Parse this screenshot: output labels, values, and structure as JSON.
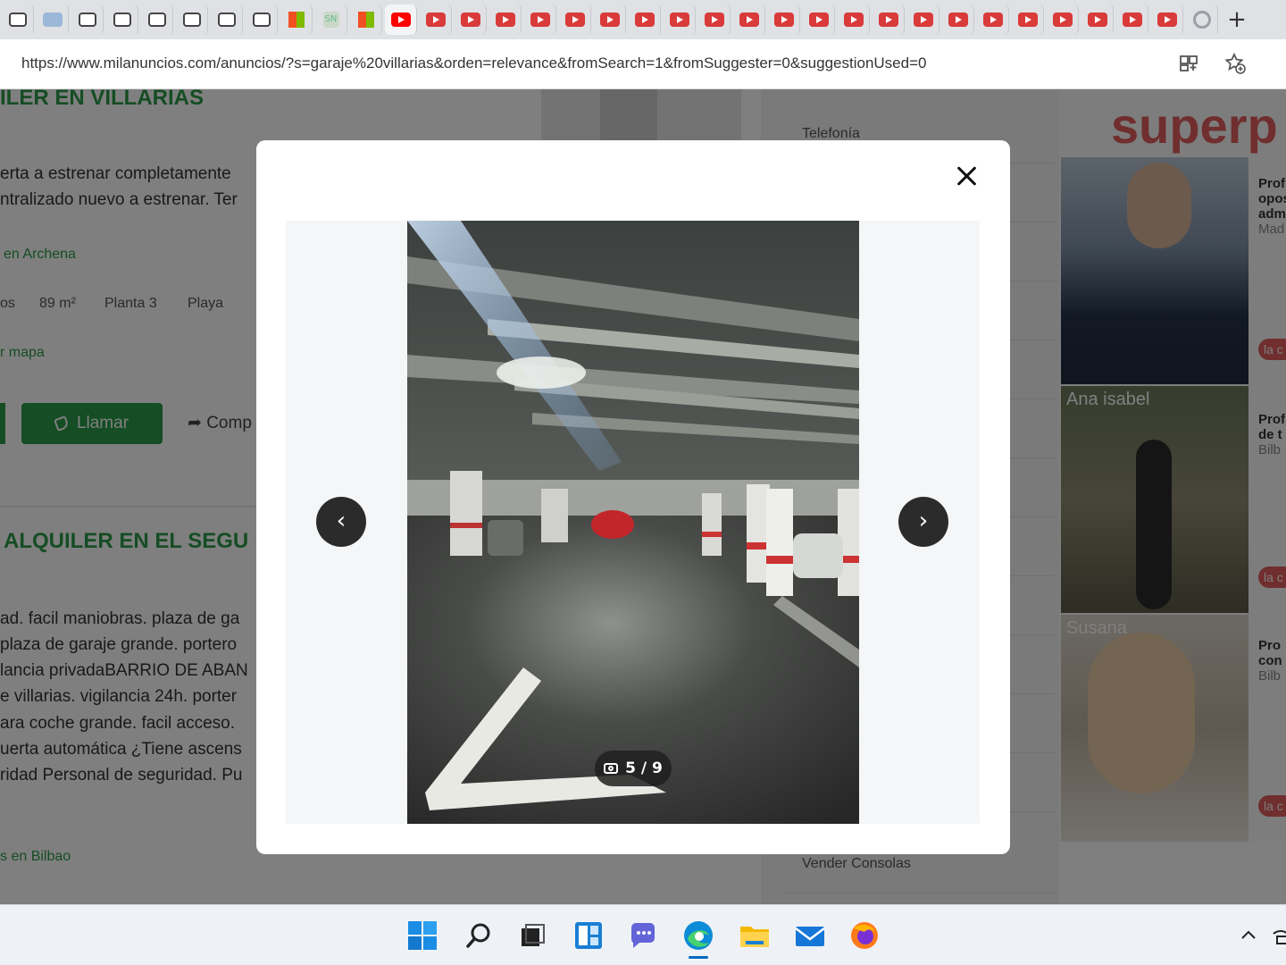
{
  "browser": {
    "url": "https://www.milanuncios.com/anuncios/?s=garaje%20villarias&orden=relevance&fromSearch=1&fromSuggester=0&suggestionUsed=0",
    "tabs": [
      {
        "icon": "search-icon"
      },
      {
        "icon": "gl-icon"
      },
      {
        "icon": "milanuncios-icon"
      },
      {
        "icon": "milanuncios-icon"
      },
      {
        "icon": "milanuncios-icon"
      },
      {
        "icon": "milanuncios-icon"
      },
      {
        "icon": "milanuncios-icon"
      },
      {
        "icon": "milanuncios-icon"
      },
      {
        "icon": "microsoft-icon"
      },
      {
        "icon": "sn-icon",
        "text": "SN"
      },
      {
        "icon": "microsoft-icon"
      },
      {
        "icon": "youtube-icon",
        "active": true
      },
      {
        "icon": "youtube-icon"
      },
      {
        "icon": "youtube-icon"
      },
      {
        "icon": "youtube-icon"
      },
      {
        "icon": "youtube-icon"
      },
      {
        "icon": "youtube-icon"
      },
      {
        "icon": "youtube-icon"
      },
      {
        "icon": "youtube-icon"
      },
      {
        "icon": "youtube-icon"
      },
      {
        "icon": "youtube-icon"
      },
      {
        "icon": "youtube-icon"
      },
      {
        "icon": "youtube-icon"
      },
      {
        "icon": "youtube-icon"
      },
      {
        "icon": "youtube-icon"
      },
      {
        "icon": "youtube-icon"
      },
      {
        "icon": "youtube-icon"
      },
      {
        "icon": "youtube-icon"
      },
      {
        "icon": "youtube-icon"
      },
      {
        "icon": "youtube-icon"
      },
      {
        "icon": "youtube-icon"
      },
      {
        "icon": "youtube-icon"
      },
      {
        "icon": "youtube-icon"
      },
      {
        "icon": "youtube-icon"
      },
      {
        "icon": "google-icon"
      }
    ],
    "new_tab": "+"
  },
  "background": {
    "listing1": {
      "title": "ILER EN VILLARIAS",
      "desc_line1": "erta a estrenar completamente",
      "desc_line2": "ntralizado nuevo a estrenar. Ter",
      "location": "en Archena",
      "features": [
        "os",
        "89 m²",
        "Planta 3",
        "Playa"
      ],
      "map_link": "r mapa",
      "call_label": "Llamar",
      "share_label": "Comp"
    },
    "listing2": {
      "title": "ALQUILER EN EL SEGU",
      "desc_lines": [
        "ad. facil maniobras. plaza de ga",
        "plaza de garaje grande. portero",
        "lancia privadaBARRIO DE ABAN",
        "e villarias. vigilancia 24h. porter",
        "ara coche grande. facil acceso.",
        "uerta automática ¿Tiene ascens",
        "ridad Personal de seguridad. Pu"
      ],
      "location": "s en Bilbao"
    },
    "categories": [
      "Telefonía",
      "Vender Consolas"
    ],
    "promo": {
      "headline": "superp",
      "person2_name": "Ana isabel",
      "person3_name": "Susana",
      "side_text1": [
        "Prof",
        "opos",
        "adm",
        "Mad"
      ],
      "side_text2": [
        "Prof",
        "de t",
        "Bilb"
      ],
      "side_text3": [
        "Pro",
        "con",
        "Bilb"
      ],
      "badge": "la c"
    }
  },
  "modal": {
    "counter": "5 / 9",
    "current": 5,
    "total": 9
  },
  "colors": {
    "brand_green": "#2b9a48",
    "overlay": "rgba(0,0,0,0.5)",
    "promo_red": "#e05c5c"
  },
  "taskbar": {
    "apps": [
      "windows-start-icon",
      "search-icon",
      "task-view-icon",
      "widgets-icon",
      "teams-chat-icon",
      "edge-icon",
      "file-explorer-icon",
      "mail-icon",
      "firefox-icon"
    ],
    "tray": [
      "chevron-up-icon",
      "network-icon"
    ]
  }
}
